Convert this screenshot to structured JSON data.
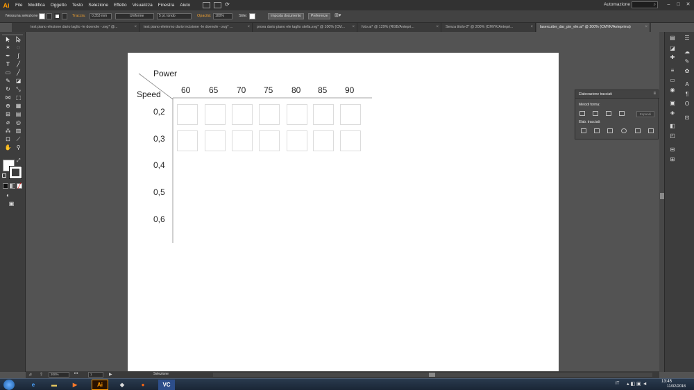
{
  "app": {
    "logo": "Ai",
    "menu": [
      "File",
      "Modifica",
      "Oggetto",
      "Testo",
      "Selezione",
      "Effetto",
      "Visualizza",
      "Finestra",
      "Aiuto"
    ],
    "workspace": "Automazione",
    "search_icon": "search-icon"
  },
  "control_bar": {
    "selection_label": "Nessuna selezione",
    "stroke_label": "Traccia:",
    "stroke_value": "0,353 mm",
    "profile_value": "Uniforme",
    "brush_value": "5 pt. tondo",
    "opacity_label": "Opacità:",
    "opacity_value": "100%",
    "style_label": "Stile:",
    "doc_setup_button": "Imposta documento",
    "preferences_button": "Preferenze"
  },
  "tabs": [
    {
      "label": "test piano elezione dario taglio -le doenole -.svg* @...",
      "active": false
    },
    {
      "label": "test piano eleimmo dario incisione -le doenole -.svg* ...",
      "active": false
    },
    {
      "label": "prova dario piano ele taglio stella.svg* @ 100% (CM...",
      "active": false
    },
    {
      "label": "foto.ai* @ 129% (RGB/Antepri...",
      "active": false
    },
    {
      "label": "Senza titolo-2* @ 200% (CMYK/Antepri...",
      "active": false
    },
    {
      "label": "lasercutter_dar_pin_ele.ai* @ 200% (CMYK/Anteprima)",
      "active": true
    }
  ],
  "artboard": {
    "power_label": "Power",
    "speed_label": "Speed",
    "power_values": [
      "60",
      "65",
      "70",
      "75",
      "80",
      "85",
      "90"
    ],
    "speed_values": [
      "0,2",
      "0,3",
      "0,4",
      "0,5",
      "0,6"
    ],
    "filled_rows": 2
  },
  "pathfinder_panel": {
    "title": "Elaborazione tracciati",
    "shape_modes_label": "Metodi forma:",
    "pathfinders_label": "Elab. tracciati:",
    "expand_button": "Espandi"
  },
  "status_bar": {
    "zoom": "200%",
    "artboard_number": "1",
    "tool_status": "Selezione"
  },
  "taskbar": {
    "language": "IT",
    "time": "13:45",
    "date": "11/02/2018",
    "apps": [
      "ie-icon",
      "explorer-icon",
      "media-icon",
      "illustrator-icon",
      "inkscape-icon",
      "firefox-icon",
      "chrome-icon",
      "vc-icon"
    ]
  },
  "colors": {
    "ai_orange": "#ff9a00",
    "ui_dark": "#323232",
    "ui_mid": "#535353",
    "artboard": "#ffffff"
  }
}
